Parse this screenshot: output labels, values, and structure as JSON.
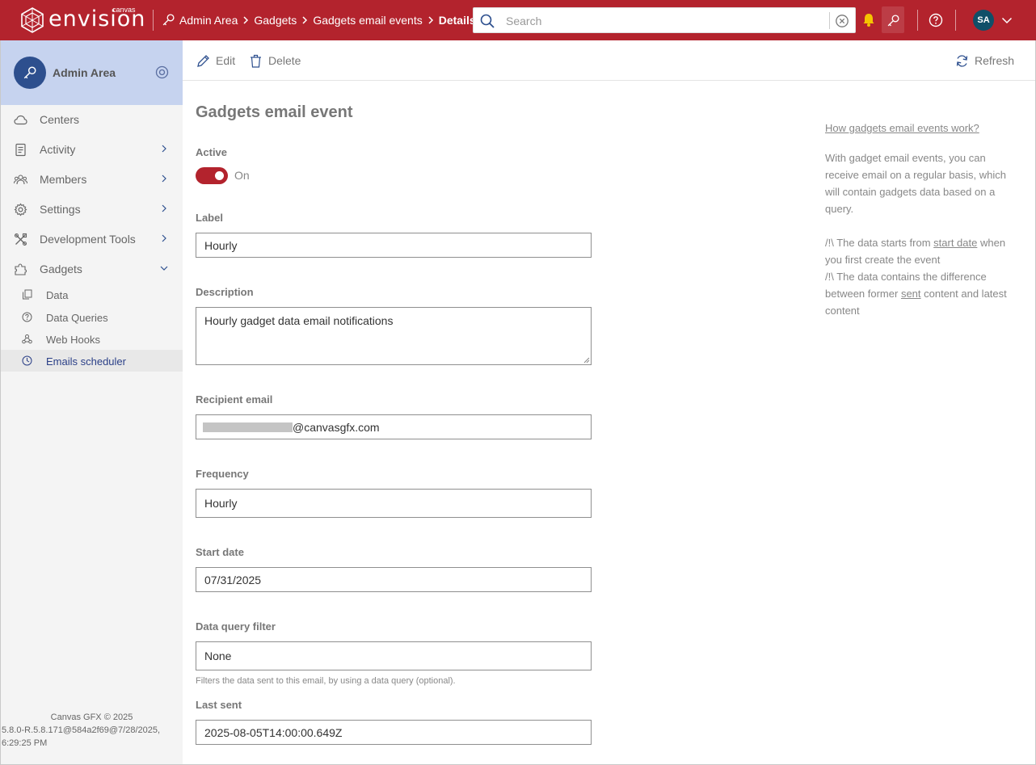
{
  "header": {
    "brand_sup": "canvas",
    "brand_word": "envision",
    "breadcrumb": [
      "Admin Area",
      "Gadgets",
      "Gadgets email events",
      "Details"
    ],
    "search_placeholder": "Search",
    "avatar_initials": "SA"
  },
  "sidebar": {
    "title": "Admin Area",
    "items": [
      {
        "label": "Centers",
        "icon": "cloud-icon"
      },
      {
        "label": "Activity",
        "icon": "activity-icon"
      },
      {
        "label": "Members",
        "icon": "members-icon"
      },
      {
        "label": "Settings",
        "icon": "gear-icon"
      },
      {
        "label": "Development Tools",
        "icon": "tools-icon"
      },
      {
        "label": "Gadgets",
        "icon": "puzzle-icon"
      }
    ],
    "subitems": [
      {
        "label": "Data",
        "icon": "copy-icon"
      },
      {
        "label": "Data Queries",
        "icon": "question-icon"
      },
      {
        "label": "Web Hooks",
        "icon": "webhook-icon"
      },
      {
        "label": "Emails scheduler",
        "icon": "clock-icon"
      }
    ],
    "footer": {
      "copyright": "Canvas GFX © 2025",
      "version": "5.8.0-R.5.8.171@584a2f69@7/28/2025, 6:29:25 PM"
    }
  },
  "toolbar": {
    "edit_label": "Edit",
    "delete_label": "Delete",
    "refresh_label": "Refresh"
  },
  "form": {
    "heading": "Gadgets email event",
    "active_label": "Active",
    "active_state": "On",
    "label_label": "Label",
    "label_value": "Hourly",
    "description_label": "Description",
    "description_value": "Hourly gadget data email notifications",
    "recipient_label": "Recipient email",
    "recipient_domain": "@canvasgfx.com",
    "frequency_label": "Frequency",
    "frequency_value": "Hourly",
    "start_date_label": "Start date",
    "start_date_value": "07/31/2025",
    "filter_label": "Data query filter",
    "filter_value": "None",
    "filter_hint": "Filters the data sent to this email, by using a data query (optional).",
    "last_sent_label": "Last sent",
    "last_sent_value": "2025-08-05T14:00:00.649Z"
  },
  "help": {
    "link": "How gadgets email events work?",
    "paragraph": "With gadget email events, you can receive email on a regular basis, which will contain gadgets data based on a query.",
    "note1_pre": "/!\\ The data starts from ",
    "note1_link": "start date",
    "note1_post": " when you first create the event",
    "note2_pre": "/!\\ The data contains the difference between former ",
    "note2_link": "sent",
    "note2_post": " content and latest content"
  },
  "colors": {
    "brand_red": "#b3232d",
    "sidebar_header": "#c6d3ef",
    "avatar_bg": "#104f68",
    "active_nav_text": "#2a3f87",
    "notification_bell": "#f5c400"
  }
}
